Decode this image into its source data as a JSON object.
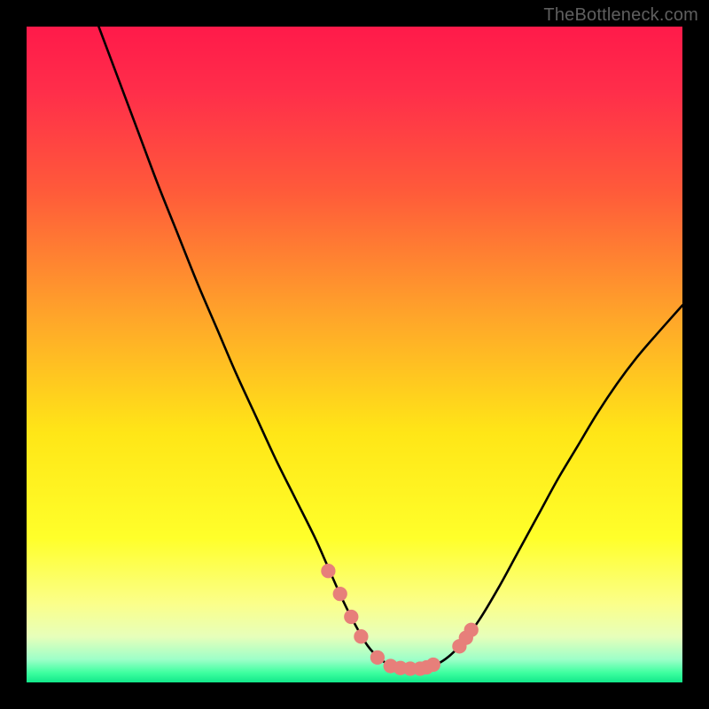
{
  "attribution": "TheBottleneck.com",
  "colors": {
    "frame": "#000000",
    "gradient_stops": [
      {
        "offset": 0.0,
        "color": "#ff1a4a"
      },
      {
        "offset": 0.1,
        "color": "#ff2e4a"
      },
      {
        "offset": 0.25,
        "color": "#ff5a3a"
      },
      {
        "offset": 0.45,
        "color": "#ffa829"
      },
      {
        "offset": 0.62,
        "color": "#ffe617"
      },
      {
        "offset": 0.78,
        "color": "#ffff2a"
      },
      {
        "offset": 0.88,
        "color": "#fbff8a"
      },
      {
        "offset": 0.93,
        "color": "#e7ffba"
      },
      {
        "offset": 0.965,
        "color": "#9dffc8"
      },
      {
        "offset": 0.985,
        "color": "#3fffa0"
      },
      {
        "offset": 1.0,
        "color": "#12e88a"
      }
    ],
    "curve": "#000000",
    "markers": "#e77f7a"
  },
  "chart_data": {
    "type": "line",
    "title": "",
    "xlabel": "",
    "ylabel": "",
    "xlim": [
      0,
      100
    ],
    "ylim": [
      0,
      100
    ],
    "series": [
      {
        "name": "bottleneck-curve",
        "x": [
          11,
          14,
          17,
          20,
          23,
          26,
          29,
          32,
          35,
          38,
          41,
          44,
          46,
          48,
          50,
          52,
          54,
          56,
          58,
          60,
          63,
          66,
          69,
          72,
          75,
          78,
          81,
          84,
          87,
          90,
          93,
          96,
          100
        ],
        "y": [
          100,
          92,
          84,
          76,
          68.5,
          61,
          54,
          47,
          40.5,
          34,
          28,
          22,
          17.5,
          13,
          9,
          5.6,
          3.5,
          2.4,
          2.1,
          2.1,
          3.0,
          5.5,
          9.5,
          14.5,
          20,
          25.5,
          31,
          36,
          41,
          45.5,
          49.5,
          53,
          57.5
        ]
      }
    ],
    "markers": [
      {
        "x": 46.0,
        "y": 17.0
      },
      {
        "x": 47.8,
        "y": 13.5
      },
      {
        "x": 49.5,
        "y": 10.0
      },
      {
        "x": 51.0,
        "y": 7.0
      },
      {
        "x": 53.5,
        "y": 3.8
      },
      {
        "x": 55.5,
        "y": 2.5
      },
      {
        "x": 57.0,
        "y": 2.2
      },
      {
        "x": 58.5,
        "y": 2.1
      },
      {
        "x": 60.0,
        "y": 2.1
      },
      {
        "x": 61.0,
        "y": 2.3
      },
      {
        "x": 62.0,
        "y": 2.7
      },
      {
        "x": 66.0,
        "y": 5.5
      },
      {
        "x": 67.0,
        "y": 6.8
      },
      {
        "x": 67.8,
        "y": 8.0
      }
    ],
    "marker_radius": 1.1
  }
}
